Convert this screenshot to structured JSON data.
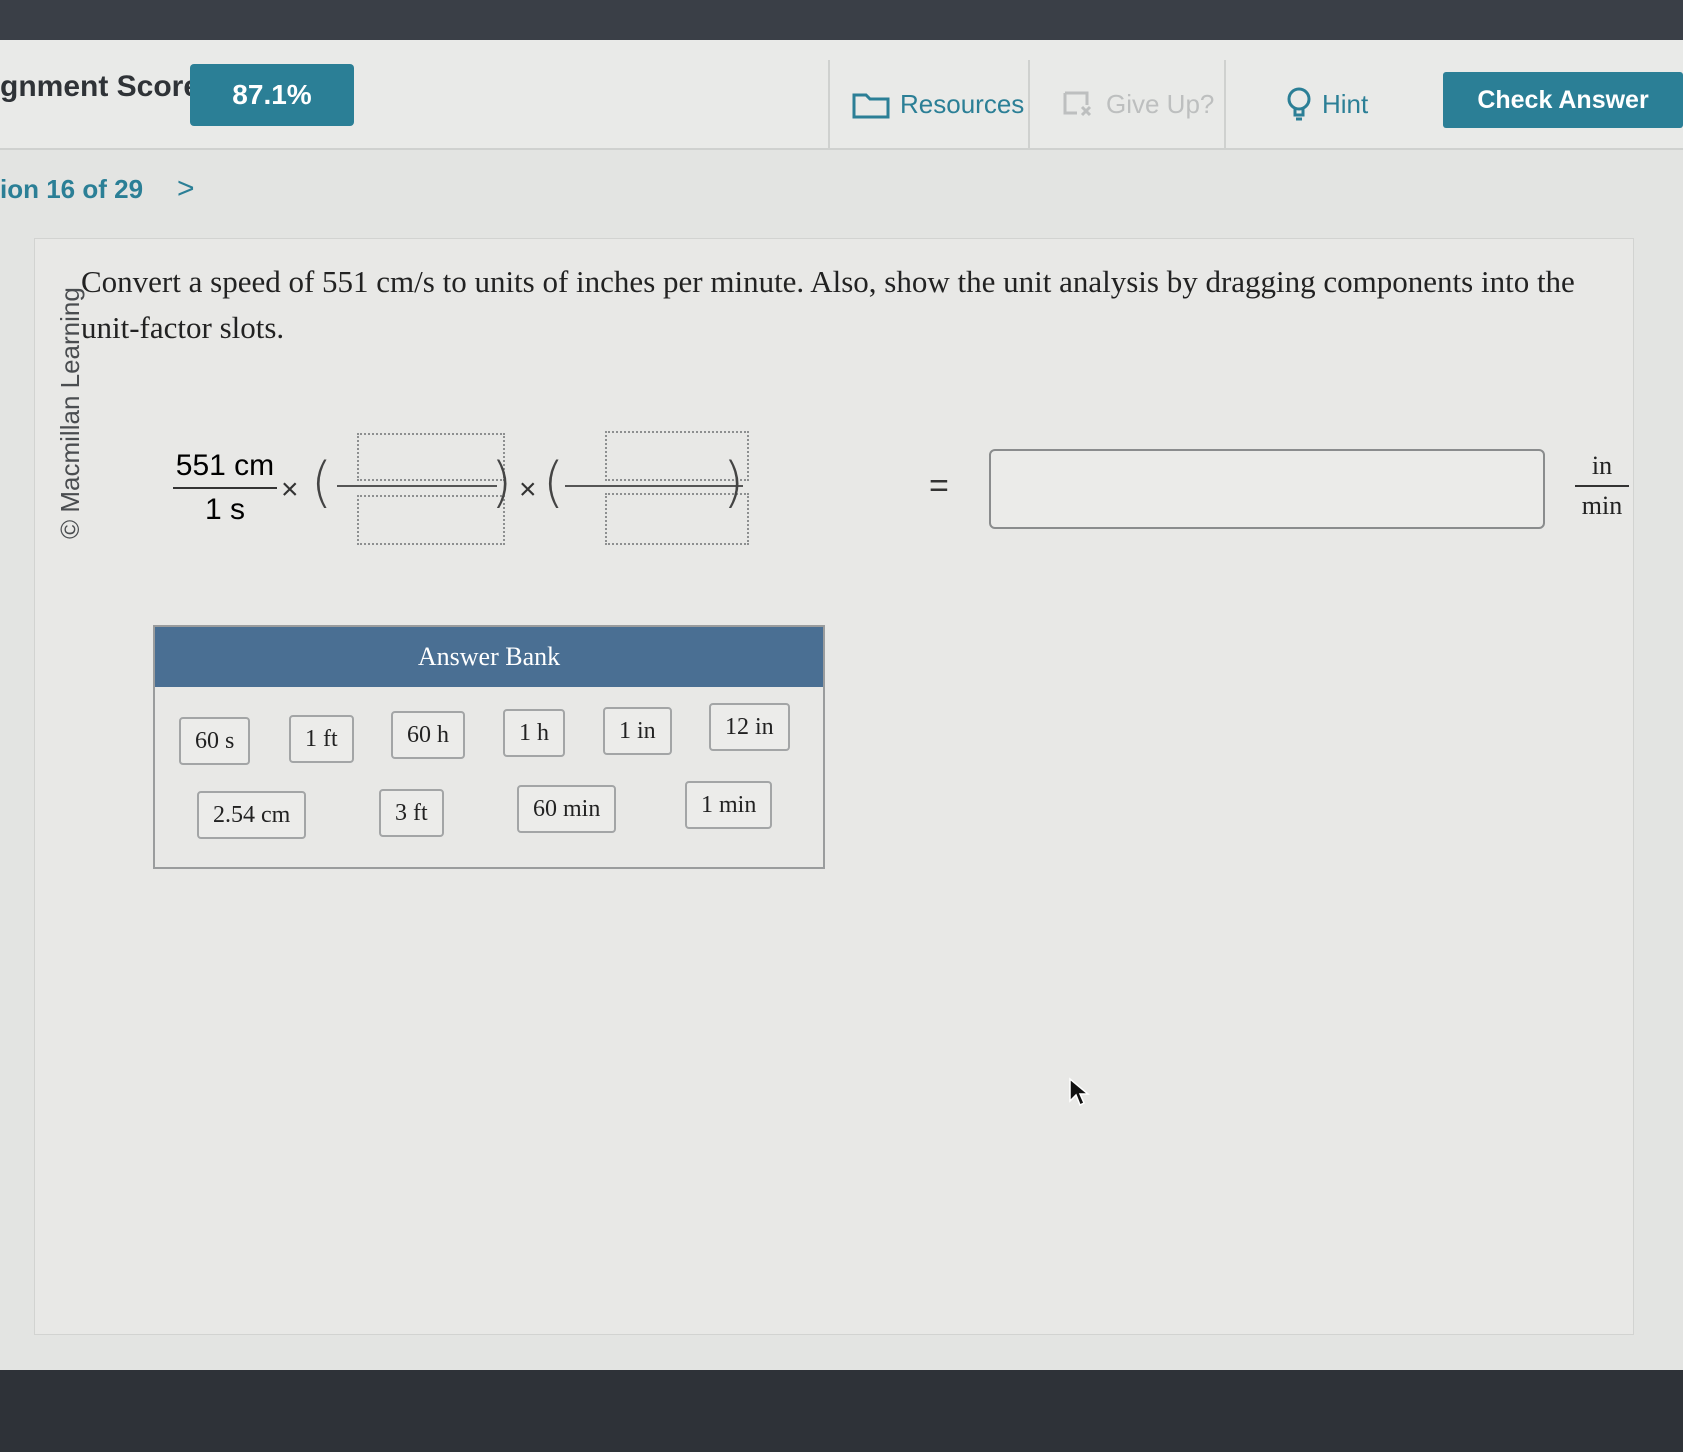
{
  "header": {
    "score_label": "gnment Score:",
    "score_value": "87.1%",
    "resources_label": "Resources",
    "give_up_label": "Give Up?",
    "hint_label": "Hint",
    "check_answer_label": "Check Answer"
  },
  "nav": {
    "question_position": "ion 16 of 29",
    "next_chevron": ">"
  },
  "panel": {
    "copyright": "© Macmillan Learning",
    "question_text": "Convert a speed of 551 cm/s to units of inches per minute. Also, show the unit analysis by dragging components into the unit-factor slots."
  },
  "equation": {
    "given_numerator": "551 cm",
    "given_denominator": "1 s",
    "times_symbol": "×",
    "open_paren": "(",
    "close_paren": ")",
    "equals": "=",
    "answer_value": "",
    "unit_numerator": "in",
    "unit_denominator": "min"
  },
  "answer_bank": {
    "title": "Answer Bank",
    "chips": [
      "60 s",
      "1 ft",
      "60 h",
      "1 h",
      "1 in",
      "12 in",
      "2.54 cm",
      "3 ft",
      "60 min",
      "1 min"
    ]
  },
  "icons": {
    "resources": "folder-icon",
    "give_up": "give-up-icon",
    "hint": "lightbulb-icon",
    "cursor": "mouse-pointer-icon"
  },
  "colors": {
    "accent": "#2b7f96",
    "bank_header": "#4a6f93"
  }
}
